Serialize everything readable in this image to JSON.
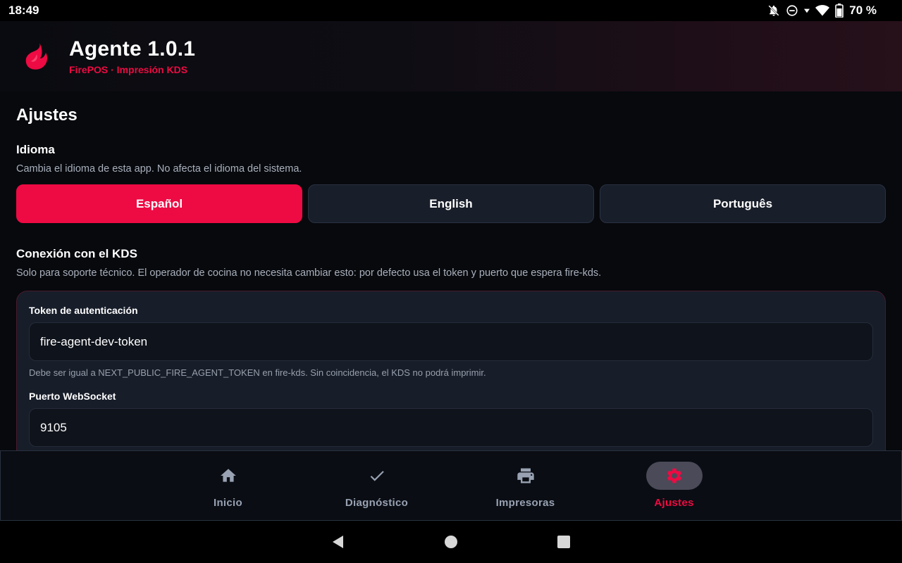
{
  "status_bar": {
    "time": "18:49",
    "battery": "70 %"
  },
  "header": {
    "title": "Agente 1.0.1",
    "subtitle": "FirePOS · Impresión KDS"
  },
  "page_title": "Ajustes",
  "language": {
    "title": "Idioma",
    "description": "Cambia el idioma de esta app. No afecta el idioma del sistema.",
    "options": [
      "Español",
      "English",
      "Português"
    ],
    "selected": "Español"
  },
  "kds": {
    "title": "Conexión con el KDS",
    "description": "Solo para soporte técnico. El operador de cocina no necesita cambiar esto: por defecto usa el token y puerto que espera fire-kds.",
    "token_label": "Token de autenticación",
    "token_value": "fire-agent-dev-token",
    "token_help": "Debe ser igual a NEXT_PUBLIC_FIRE_AGENT_TOKEN en fire-kds. Sin coincidencia, el KDS no podrá imprimir.",
    "port_label": "Puerto WebSocket",
    "port_value": "9105"
  },
  "bottom_nav": {
    "items": [
      {
        "label": "Inicio",
        "icon": "home-icon"
      },
      {
        "label": "Diagnóstico",
        "icon": "check-icon"
      },
      {
        "label": "Impresoras",
        "icon": "printer-icon"
      },
      {
        "label": "Ajustes",
        "icon": "gear-icon"
      }
    ],
    "active": "Ajustes"
  },
  "colors": {
    "accent": "#ee0a43",
    "background": "#07090d",
    "card": "#171d29",
    "input": "#0f131b",
    "inactive": "#98a2b3"
  }
}
